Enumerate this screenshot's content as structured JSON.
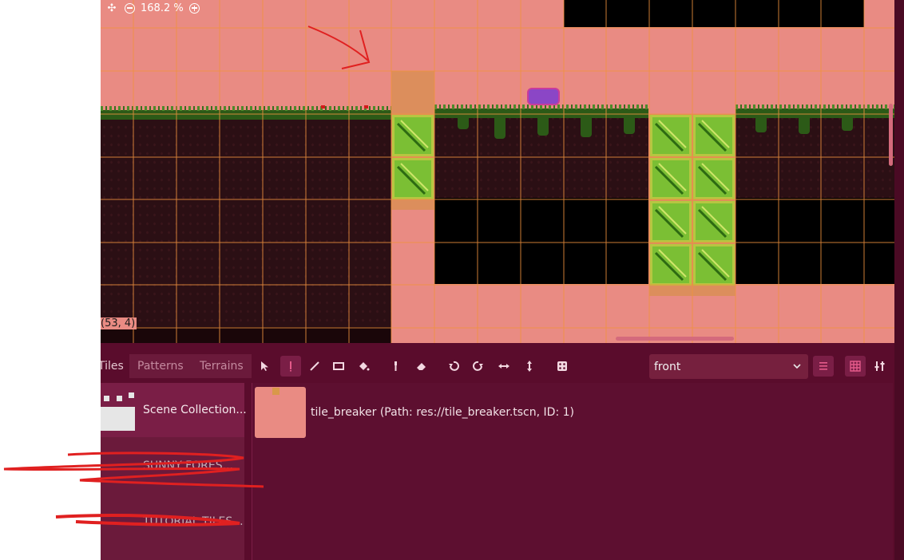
{
  "zoom": {
    "reset_icon": "reset-zoom-icon",
    "zoom_out_icon": "zoom-out-icon",
    "value": "168.2 %",
    "zoom_in_icon": "zoom-in-icon"
  },
  "viewport": {
    "cell_coordinate": "(53, 4)"
  },
  "tabs": {
    "tiles": "Tiles",
    "patterns": "Patterns",
    "terrains": "Terrains"
  },
  "tools": [
    {
      "name": "select-tool",
      "icon": "pointer-icon",
      "active": false
    },
    {
      "name": "paint-tool",
      "icon": "pencil-icon",
      "active": true
    },
    {
      "name": "line-tool",
      "icon": "line-icon",
      "active": false
    },
    {
      "name": "rect-tool",
      "icon": "rectangle-icon",
      "active": false
    },
    {
      "name": "bucket-tool",
      "icon": "bucket-icon",
      "active": false
    },
    {
      "name": "picker-tool",
      "icon": "eyedropper-icon",
      "active": false
    },
    {
      "name": "eraser-tool",
      "icon": "eraser-icon",
      "active": false
    },
    {
      "name": "rotate-left-tool",
      "icon": "rotate-left-icon",
      "active": false
    },
    {
      "name": "rotate-right-tool",
      "icon": "rotate-right-icon",
      "active": false
    },
    {
      "name": "flip-h-tool",
      "icon": "flip-horizontal-icon",
      "active": false
    },
    {
      "name": "flip-v-tool",
      "icon": "flip-vertical-icon",
      "active": false
    },
    {
      "name": "random-tool",
      "icon": "dice-icon",
      "active": false
    }
  ],
  "layer_select": {
    "value": "front"
  },
  "view_toggles": {
    "list_icon": "list-view-icon",
    "grid_icon": "grid-view-icon",
    "settings_icon": "tools-settings-icon"
  },
  "sources": [
    {
      "label": "Scene Collection...",
      "selected": true
    },
    {
      "label": "SUNNY FORES...",
      "selected": false
    },
    {
      "label": "TUTORIAL TILES...",
      "selected": false
    }
  ],
  "tile": {
    "text": "tile_breaker (Path: res://tile_breaker.tscn, ID: 1)"
  },
  "colors": {
    "canvas_bg": "#e98b83",
    "grid_line": "#f0923e",
    "panel_bg": "#5a0c2c",
    "panel_sel": "#7a1e46",
    "tile_green": "#7bbf34",
    "annotation_red": "#e02020"
  }
}
